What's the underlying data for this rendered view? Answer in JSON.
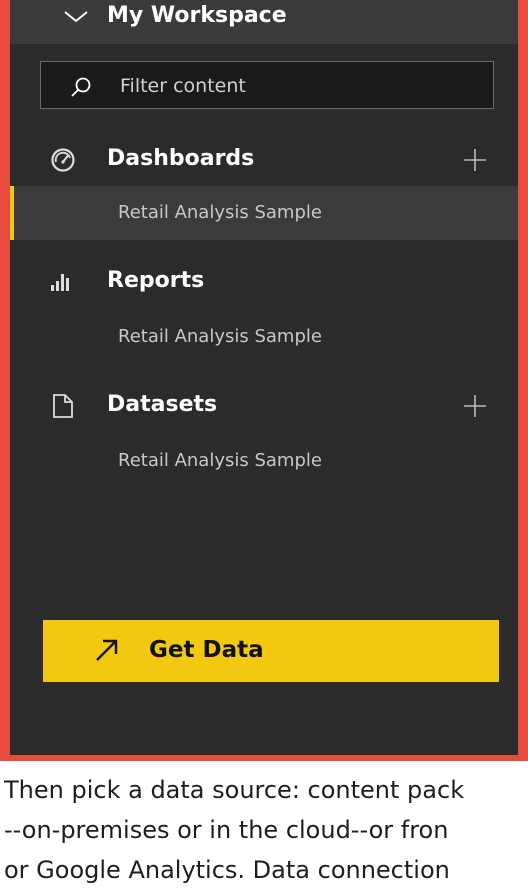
{
  "workspace": {
    "title": "My Workspace"
  },
  "filter": {
    "placeholder": "Filter content"
  },
  "sections": [
    {
      "label": "Dashboards",
      "item": "Retail Analysis Sample",
      "icon": "gauge-icon",
      "has_add": true
    },
    {
      "label": "Reports",
      "item": "Retail Analysis Sample",
      "icon": "bar-chart-icon",
      "has_add": false
    },
    {
      "label": "Datasets",
      "item": "Retail Analysis Sample",
      "icon": "document-icon",
      "has_add": true
    }
  ],
  "get_data": {
    "label": "Get Data",
    "icon": "arrow-up-right-icon"
  },
  "caption": {
    "line1": "Then pick a data source: content pack",
    "line2": "--on-premises or in the cloud--or fron",
    "line3": "or Google Analytics. Data connection"
  },
  "colors": {
    "panel": "#2b2b2b",
    "header": "#3a3a3a",
    "accent": "#f2c811",
    "frame": "#e74c3c",
    "selected_row": "#3b3b3b"
  }
}
